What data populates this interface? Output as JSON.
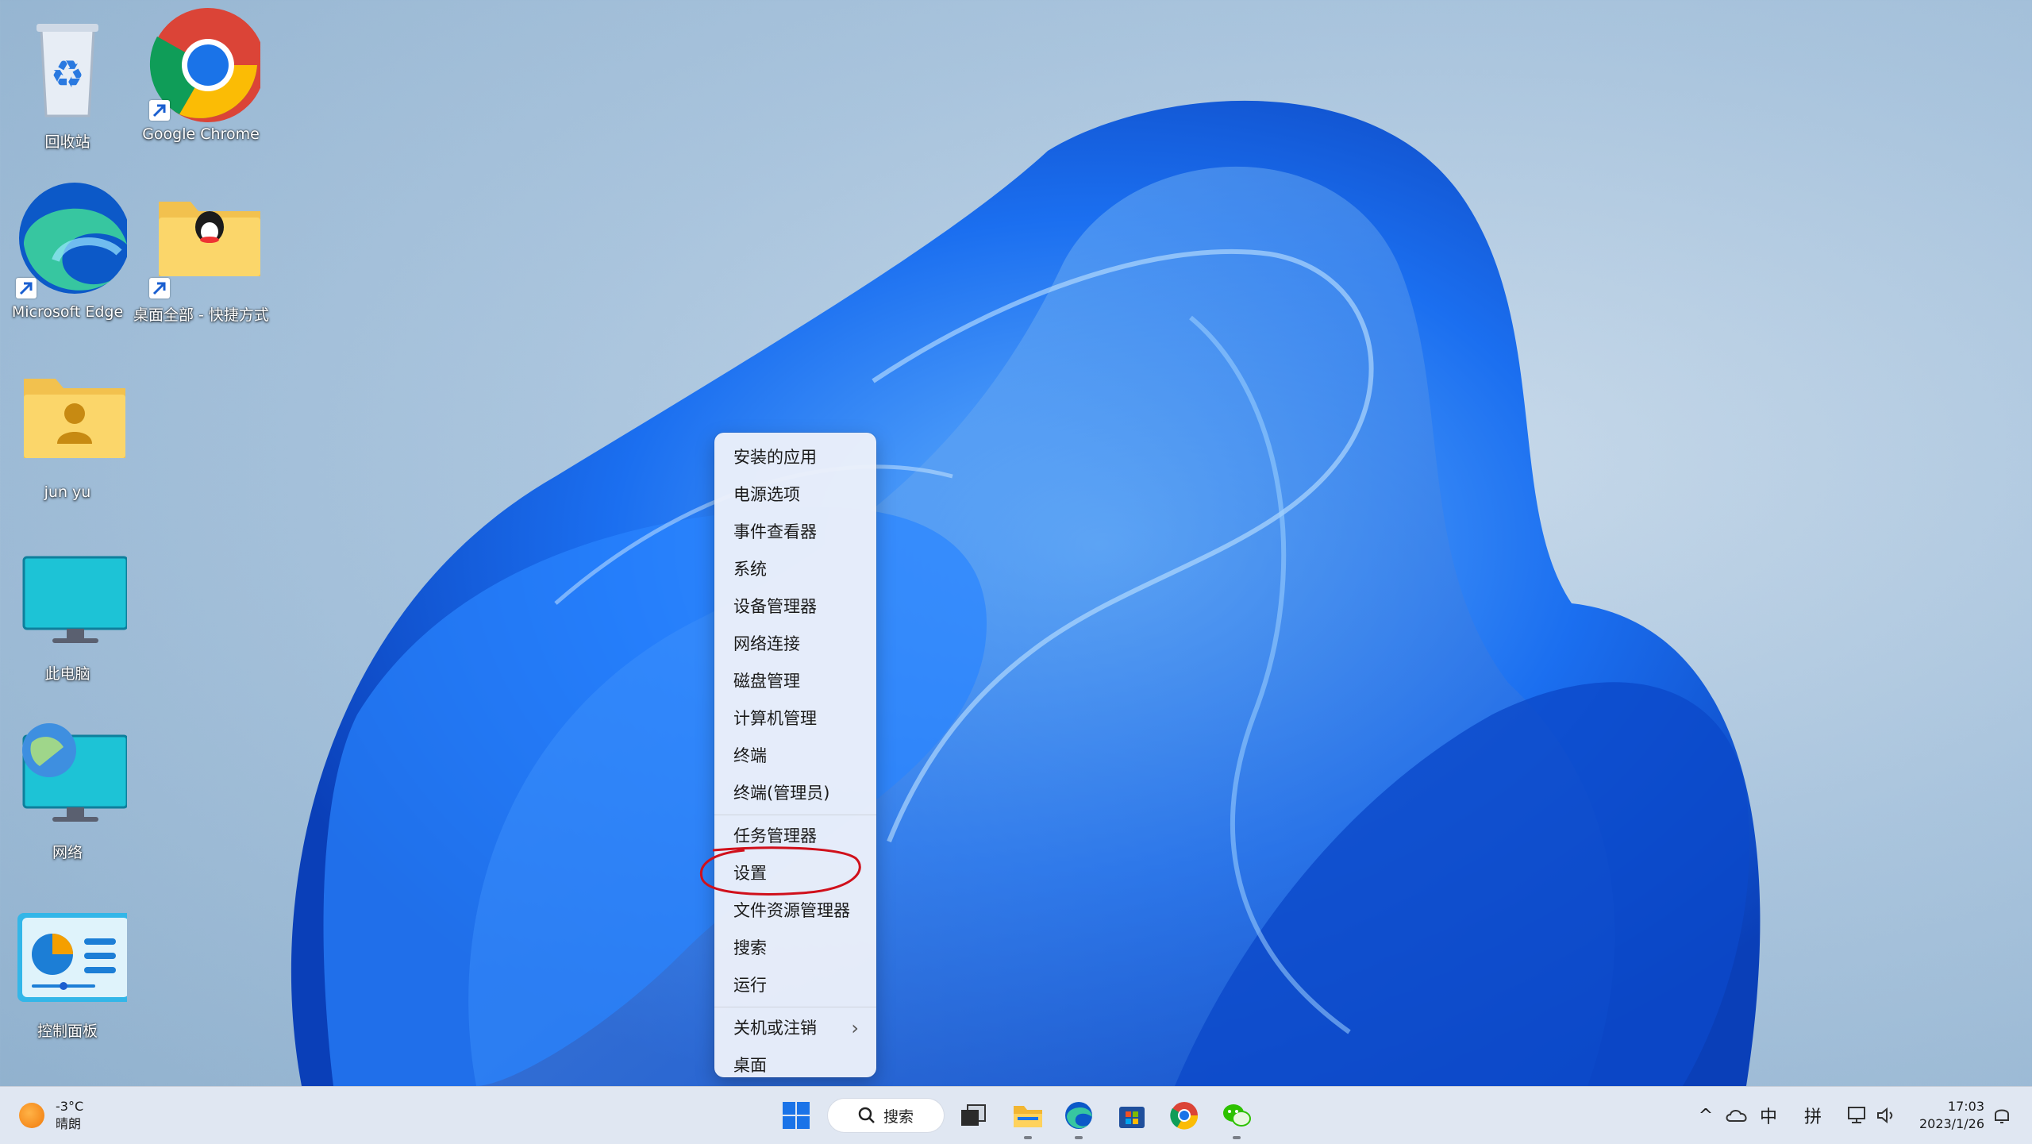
{
  "desktop": {
    "icons": [
      {
        "label": "回收站"
      },
      {
        "label": "Google Chrome"
      },
      {
        "label": "Microsoft Edge"
      },
      {
        "label": "桌面全部 - 快捷方式"
      },
      {
        "label": "jun yu"
      },
      {
        "label": "此电脑"
      },
      {
        "label": "网络"
      },
      {
        "label": "控制面板"
      }
    ]
  },
  "context_menu": {
    "items": [
      "安装的应用",
      "电源选项",
      "事件查看器",
      "系统",
      "设备管理器",
      "网络连接",
      "磁盘管理",
      "计算机管理",
      "终端",
      "终端(管理员)",
      "任务管理器",
      "设置",
      "文件资源管理器",
      "搜索",
      "运行",
      "关机或注销",
      "桌面"
    ],
    "submenu_arrow": "›",
    "highlighted_item": "设置",
    "highlight_color": "#d0101b"
  },
  "taskbar": {
    "weather": {
      "temp": "-3°C",
      "condition": "晴朗"
    },
    "search_label": "搜索",
    "pinned": [
      "start-icon",
      "search",
      "task-view-icon",
      "file-explorer-icon",
      "edge-icon",
      "store-icon",
      "chrome-icon",
      "wechat-icon"
    ],
    "tray": {
      "chevron": "^",
      "ime_lang": "中",
      "ime_mode": "拼"
    },
    "clock": {
      "time": "17:03",
      "date": "2023/1/26"
    }
  },
  "colors": {
    "bloom": "#1a63e8",
    "taskbar_bg": "#e2e8f3",
    "menu_bg": "#eceffa"
  }
}
